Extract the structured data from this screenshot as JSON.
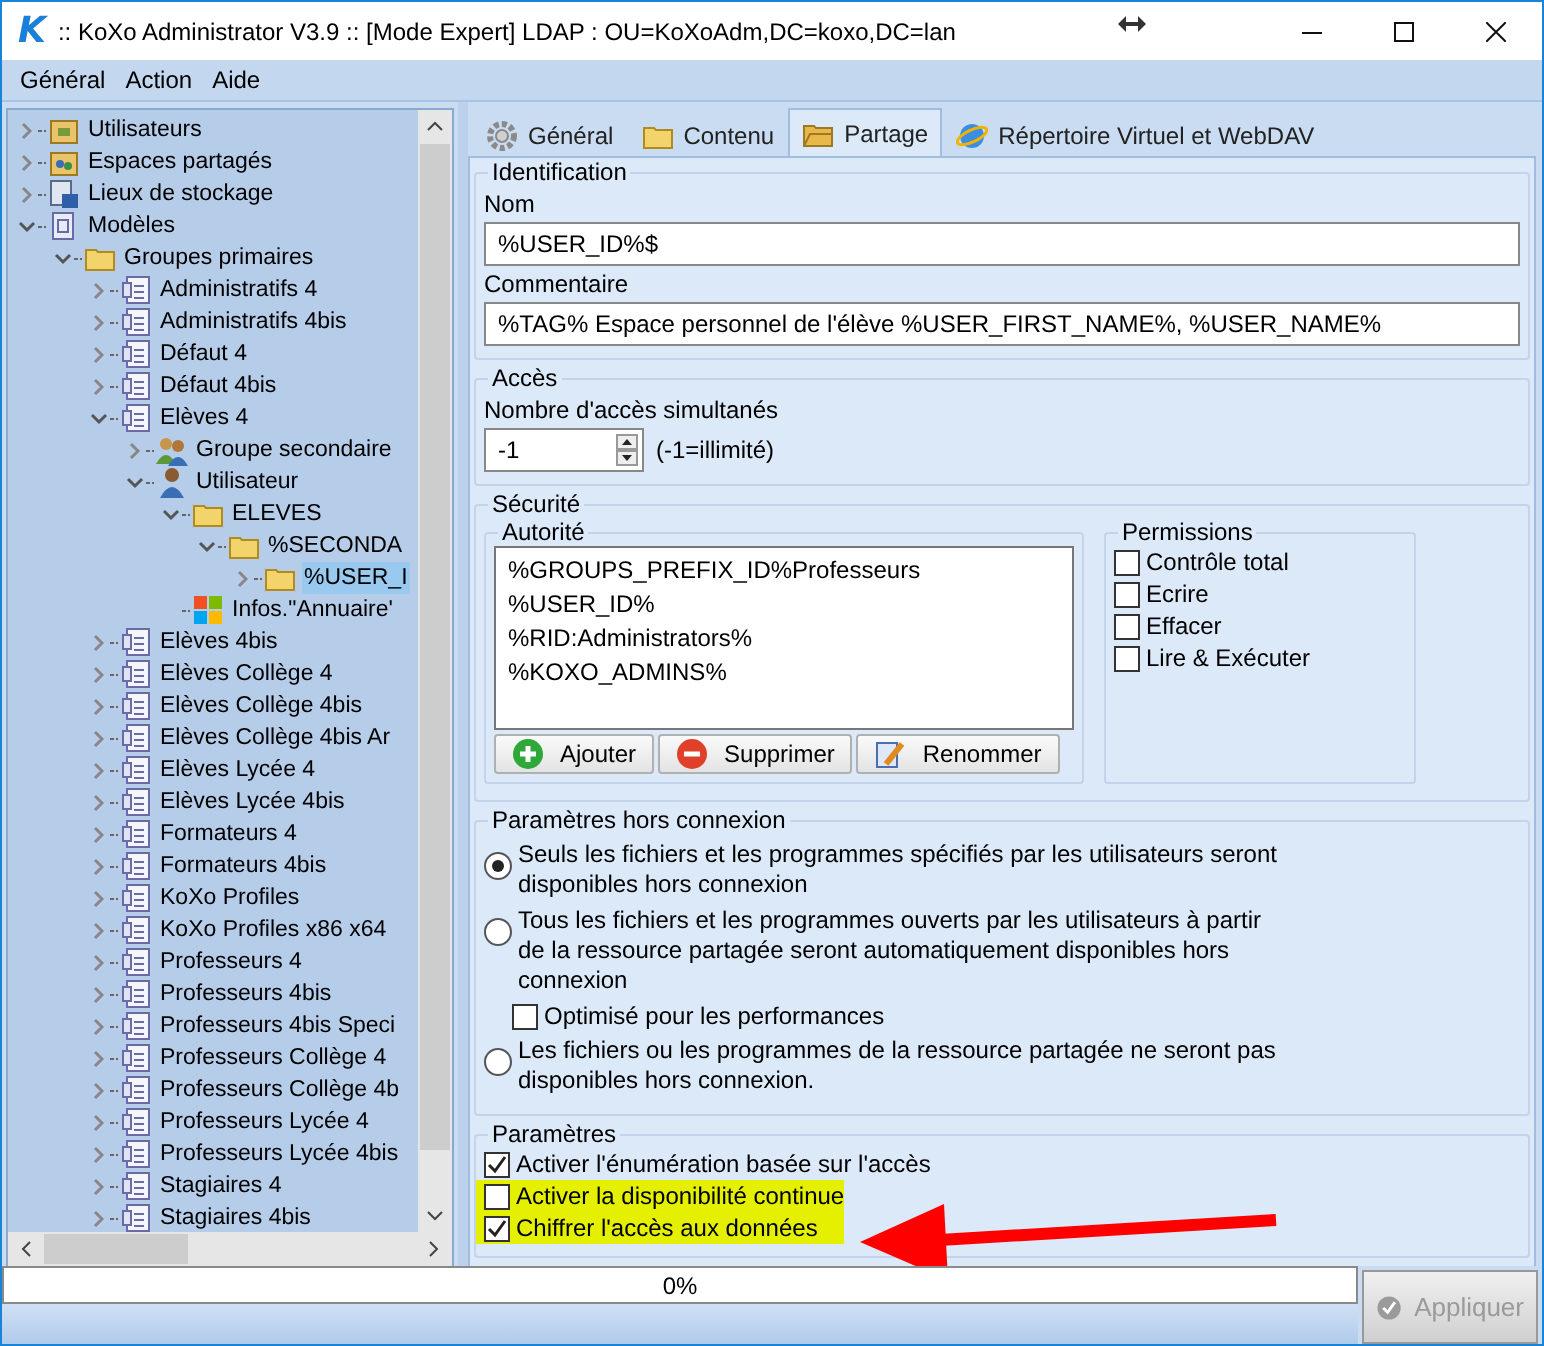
{
  "window": {
    "logo": "K",
    "title": ":: KoXo Administrator V3.9 :: [Mode Expert] LDAP : OU=KoXoAdm,DC=koxo,DC=lan"
  },
  "menu": [
    "Général",
    "Action",
    "Aide"
  ],
  "tree": [
    {
      "label": "Utilisateurs",
      "kind": "box",
      "expanded": false,
      "selected": false
    },
    {
      "label": "Espaces partagés",
      "kind": "share",
      "expanded": false,
      "selected": false
    },
    {
      "label": "Lieux de stockage",
      "kind": "storage",
      "expanded": false,
      "selected": false
    },
    {
      "label": "Modèles",
      "kind": "models",
      "expanded": true,
      "selected": false,
      "children": [
        {
          "label": "Groupes primaires",
          "kind": "folder",
          "expanded": true,
          "selected": false,
          "children": [
            {
              "label": "Administratifs 4",
              "kind": "template",
              "expanded": false,
              "selected": false
            },
            {
              "label": "Administratifs 4bis",
              "kind": "template",
              "expanded": false,
              "selected": false
            },
            {
              "label": "Défaut 4",
              "kind": "template",
              "expanded": false,
              "selected": false
            },
            {
              "label": "Défaut 4bis",
              "kind": "template",
              "expanded": false,
              "selected": false
            },
            {
              "label": "Elèves 4",
              "kind": "template",
              "expanded": true,
              "selected": false,
              "children": [
                {
                  "label": "Groupe secondaire",
                  "kind": "group",
                  "expanded": false,
                  "selected": false
                },
                {
                  "label": "Utilisateur",
                  "kind": "user",
                  "expanded": true,
                  "selected": false,
                  "children": [
                    {
                      "label": "ELEVES",
                      "kind": "folder",
                      "expanded": true,
                      "selected": false,
                      "children": [
                        {
                          "label": "%SECONDA",
                          "kind": "folder",
                          "expanded": true,
                          "selected": false,
                          "children": [
                            {
                              "label": "%USER_I",
                              "kind": "folder",
                              "expanded": false,
                              "selected": true
                            }
                          ]
                        }
                      ]
                    },
                    {
                      "label": "Infos.\"Annuaire'",
                      "kind": "windows",
                      "selected": false
                    }
                  ]
                }
              ]
            },
            {
              "label": "Elèves 4bis",
              "kind": "template",
              "expanded": false,
              "selected": false
            },
            {
              "label": "Elèves Collège 4",
              "kind": "template",
              "expanded": false,
              "selected": false
            },
            {
              "label": "Elèves Collège 4bis",
              "kind": "template",
              "expanded": false,
              "selected": false
            },
            {
              "label": "Elèves Collège 4bis Ar",
              "kind": "template",
              "expanded": false,
              "selected": false
            },
            {
              "label": "Elèves Lycée 4",
              "kind": "template",
              "expanded": false,
              "selected": false
            },
            {
              "label": "Elèves Lycée 4bis",
              "kind": "template",
              "expanded": false,
              "selected": false
            },
            {
              "label": "Formateurs 4",
              "kind": "template",
              "expanded": false,
              "selected": false
            },
            {
              "label": "Formateurs 4bis",
              "kind": "template",
              "expanded": false,
              "selected": false
            },
            {
              "label": "KoXo Profiles",
              "kind": "template",
              "expanded": false,
              "selected": false
            },
            {
              "label": "KoXo Profiles x86 x64",
              "kind": "template",
              "expanded": false,
              "selected": false
            },
            {
              "label": "Professeurs 4",
              "kind": "template",
              "expanded": false,
              "selected": false
            },
            {
              "label": "Professeurs 4bis",
              "kind": "template",
              "expanded": false,
              "selected": false
            },
            {
              "label": "Professeurs 4bis Speci",
              "kind": "template",
              "expanded": false,
              "selected": false
            },
            {
              "label": "Professeurs Collège 4",
              "kind": "template",
              "expanded": false,
              "selected": false
            },
            {
              "label": "Professeurs Collège 4b",
              "kind": "template",
              "expanded": false,
              "selected": false
            },
            {
              "label": "Professeurs Lycée 4",
              "kind": "template",
              "expanded": false,
              "selected": false
            },
            {
              "label": "Professeurs Lycée 4bis",
              "kind": "template",
              "expanded": false,
              "selected": false
            },
            {
              "label": "Stagiaires 4",
              "kind": "template",
              "expanded": false,
              "selected": false
            },
            {
              "label": "Stagiaires 4bis",
              "kind": "template",
              "expanded": false,
              "selected": false
            }
          ]
        }
      ]
    }
  ],
  "tabs": [
    {
      "label": "Général",
      "kind": "gear",
      "selected": false
    },
    {
      "label": "Contenu",
      "kind": "folder",
      "selected": false
    },
    {
      "label": "Partage",
      "kind": "share",
      "selected": true
    },
    {
      "label": "Répertoire Virtuel et WebDAV",
      "kind": "globe",
      "selected": false
    }
  ],
  "identification": {
    "title": "Identification",
    "name_label": "Nom",
    "name_value": "%USER_ID%$",
    "comment_label": "Commentaire",
    "comment_value": "%TAG% Espace personnel de l'élève %USER_FIRST_NAME%, %USER_NAME%"
  },
  "access": {
    "title": "Accès",
    "label": "Nombre d'accès simultanés",
    "value": "-1",
    "hint": "(-1=illimité)"
  },
  "security": {
    "title": "Sécurité",
    "authority_title": "Autorité",
    "authorities": [
      "%GROUPS_PREFIX_ID%Professeurs",
      "%USER_ID%",
      "%RID:Administrators%",
      "%KOXO_ADMINS%"
    ],
    "buttons": [
      {
        "label": "Ajouter",
        "kind": "add"
      },
      {
        "label": "Supprimer",
        "kind": "remove"
      },
      {
        "label": "Renommer",
        "kind": "rename"
      }
    ],
    "permissions_title": "Permissions",
    "permissions": [
      {
        "label": "Contrôle total",
        "checked": false
      },
      {
        "label": "Ecrire",
        "checked": false
      },
      {
        "label": "Effacer",
        "checked": false
      },
      {
        "label": "Lire & Exécuter",
        "checked": false
      }
    ]
  },
  "offline": {
    "title": "Paramètres hors connexion",
    "options": [
      {
        "kind": "radio",
        "text": "Seuls les fichiers et les programmes spécifiés par les utilisateurs seront disponibles hors connexion",
        "selected": true
      },
      {
        "kind": "radio",
        "text": "Tous les fichiers et les programmes ouverts par les utilisateurs à partir de la ressource partagée seront automatiquement disponibles hors connexion",
        "selected": false
      },
      {
        "kind": "checkbox",
        "text": "Optimisé pour les performances",
        "checked": false
      },
      {
        "kind": "radio",
        "text": "Les fichiers ou les programmes de la ressource partagée ne seront pas disponibles hors connexion.",
        "selected": false
      }
    ]
  },
  "parameters": {
    "title": "Paramètres",
    "items": [
      {
        "label": "Activer l'énumération basée sur l'accès",
        "checked": true,
        "highlighted": false
      },
      {
        "label": "Activer la disponibilité continue",
        "checked": false,
        "highlighted": true
      },
      {
        "label": "Chiffrer l'accès aux données",
        "checked": true,
        "highlighted": true
      }
    ],
    "annotation": {
      "kind": "arrow"
    }
  },
  "progress": {
    "level": 0,
    "text": "0%"
  },
  "apply_button": {
    "label": "Appliquer",
    "disabled": true
  }
}
